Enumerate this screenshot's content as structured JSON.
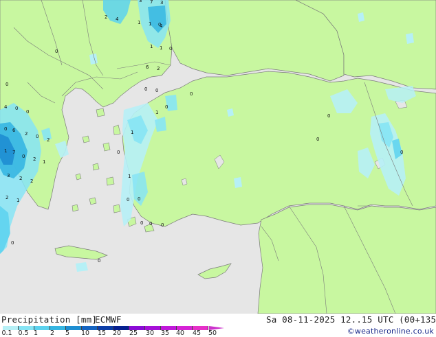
{
  "map": {
    "colors": {
      "land": "#c8f7a0",
      "sea": "#e6e6e6",
      "border": "#7a7a7a"
    },
    "cell_labels": [
      "2",
      "4",
      "3",
      "7",
      "3",
      "1",
      "1",
      "0",
      "4",
      "1",
      "1",
      "0",
      "0",
      "6",
      "2",
      "0",
      "0",
      "0",
      "0",
      "0",
      "4",
      "0",
      "0",
      "1",
      "1",
      "0",
      "6",
      "2",
      "0",
      "2",
      "1",
      "7",
      "0",
      "2",
      "3",
      "2",
      "2",
      "1",
      "2",
      "1",
      "0",
      "1",
      "0",
      "0",
      "0",
      "0",
      "0",
      "0",
      "0",
      "0",
      "0",
      "0"
    ]
  },
  "footer": {
    "title": "Precipitation [mm]",
    "model": "ECMWF",
    "valid": "Sa 08-11-2025 12..15 UTC (00+135)",
    "credit": "©weatheronline.co.uk"
  },
  "legend": {
    "ticks": [
      "0.1",
      "0.5",
      "1",
      "2",
      "5",
      "10",
      "15",
      "20",
      "25",
      "30",
      "35",
      "40",
      "45",
      "50"
    ],
    "colors": [
      "#b6f0f6",
      "#86e4f4",
      "#5cd2ee",
      "#36b6e2",
      "#1e8ed2",
      "#1464c2",
      "#0c3ea8",
      "#062090",
      "#8a0ad6",
      "#a610d8",
      "#c018da",
      "#d622d6",
      "#e630c8"
    ]
  }
}
